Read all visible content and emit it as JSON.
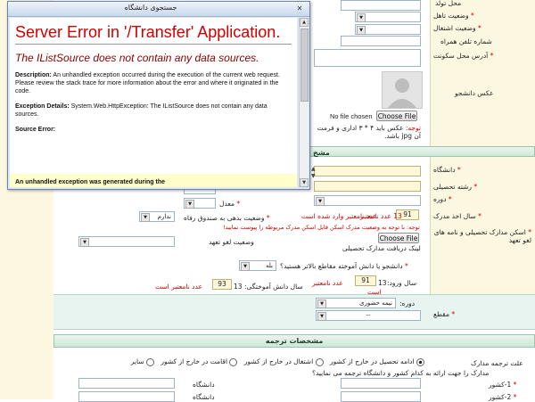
{
  "popup": {
    "title": "جستجوی دانشگاه",
    "error_title": "Server Error in '/Transfer' Application.",
    "error_message": "The IListSource does not contain any data sources.",
    "description_label": "Description:",
    "description_text": "An unhandled exception occurred during the execution of the current web request. Please review the stack trace for more information about the error and where it originated in the code.",
    "exception_label": "Exception Details:",
    "exception_text": "System.Web.HttpException: The IListSource does not contain any data sources.",
    "source_label": "Source Error:",
    "clipped_text": "An unhandled exception was generated during the"
  },
  "personal": {
    "gender_label": "محل تولد",
    "marital_label": "وضعیت تاهل",
    "employment_label": "وضعیت اشتغال",
    "mobile_label": "شماره تلفن همراه",
    "address_label": "آدرس محل سکونت",
    "photo_label": "عکس دانشجو",
    "no_file": "No file chosen",
    "choose_file": "Choose File",
    "photo_note_label": "توجه:",
    "photo_note": "عکس باید ۴ * ۳ اداری و فرمت آن jpg باشد."
  },
  "education": {
    "university_label": "دانشگاه",
    "field_label": "رشته تحصیلی",
    "period_label": "دوره",
    "average_label": "معدل",
    "degree_year_label": "سال اخذ مدرک",
    "degree_year_value": "91",
    "degree_year_hint": "عدد نامعتبر وارد شده است",
    "degree_year_invalid": "13  عدد نامعتبر",
    "degree_note": "توجه: با توجه به وضعیت مدرک اسکن فایل اسکن مدرک مربوطه را پیوست نمایید!",
    "welfare_label": "وضعیت بدهی به صندوق رفاه",
    "welfare_value": "ندارم",
    "scan_label": "اسکن مدارک تحصیلی و نامه های لغو تعهد",
    "choose_file": "Choose File",
    "scan_link": "لینک دریافت مدارک تحصیلی",
    "cancel_label": "وضعیت لغو تعهد",
    "graduate_question": "دانشجو یا دانش آموخته مقاطع بالاتر هستید؟",
    "graduate_value": "بله",
    "entry_year_label": "سال ورود:",
    "entry_year_prefix": "13",
    "entry_year_value": "91",
    "entry_invalid": "عدد نامعتبر",
    "entry_invalid_2": "است",
    "grad_year_label": "سال دانش آموختگی:",
    "grad_year_prefix": "13",
    "grad_year_value": "93",
    "grad_invalid": "عدد نامعتبر است",
    "level_label": "مقطع",
    "course_label": "دوره:",
    "course_value": "نیمه حضوری",
    "level_select": "--"
  },
  "transfer": {
    "section_title": "مشخصات ترجمه",
    "reason_label": "علت ترجمه مدارک",
    "options": [
      "ادامه تحصیل در خارج از کشور",
      "اشتغال در خارج از کشور",
      "اقامت در خارج از کشور",
      "سایر"
    ],
    "docs_question": "مدارک را جهت ارائه به کدام کشور و دانشگاه ترجمه می نمایید؟",
    "country1_label": "1-کشور",
    "country2_label": "2-کشور",
    "university_label": "دانشگاه"
  },
  "colors": {
    "error_red": "#d00000",
    "section_green": "#dcefe3",
    "field_yellow": "#fdf9d8",
    "sidebar_yellow": "#fbf7e0"
  }
}
